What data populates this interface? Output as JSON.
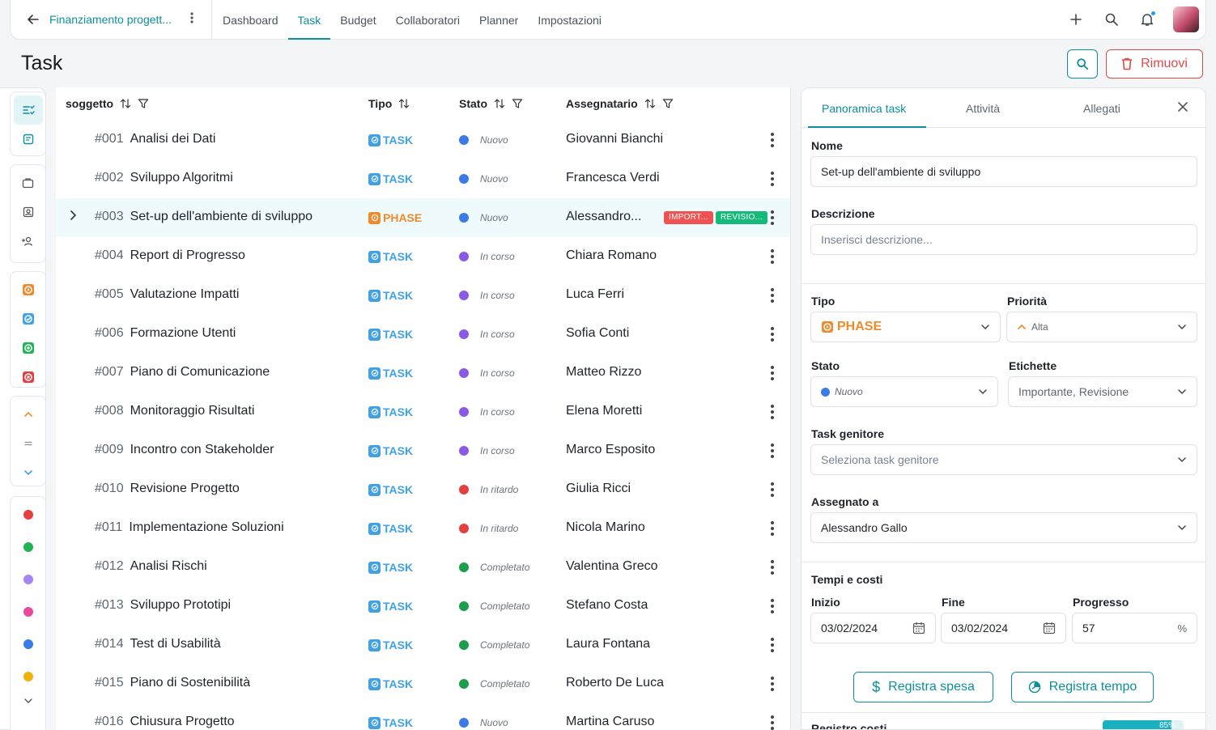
{
  "topbar": {
    "project_title": "Finanziamento progett...",
    "tabs": [
      "Dashboard",
      "Task",
      "Budget",
      "Collaboratori",
      "Planner",
      "Impostazioni"
    ],
    "active_tab": "Task"
  },
  "page": {
    "title": "Task",
    "remove_label": "Rimuovi"
  },
  "table": {
    "columns": [
      "soggetto",
      "Tipo",
      "Stato",
      "Assegnatario"
    ],
    "rows": [
      {
        "id": "#001",
        "subject": "Analisi dei Dati",
        "type": "TASK",
        "status": "Nuovo",
        "assignee": "Giovanni Bianchi"
      },
      {
        "id": "#002",
        "subject": "Sviluppo Algoritmi",
        "type": "TASK",
        "status": "Nuovo",
        "assignee": "Francesca Verdi"
      },
      {
        "id": "#003",
        "subject": "Set-up dell'ambiente di sviluppo",
        "type": "PHASE",
        "status": "Nuovo",
        "assignee": "Alessandro...",
        "tags": [
          "IMPORT...",
          "REVISIO..."
        ]
      },
      {
        "id": "#004",
        "subject": "Report di Progresso",
        "type": "TASK",
        "status": "In corso",
        "assignee": "Chiara Romano"
      },
      {
        "id": "#005",
        "subject": "Valutazione Impatti",
        "type": "TASK",
        "status": "In corso",
        "assignee": "Luca Ferri"
      },
      {
        "id": "#006",
        "subject": "Formazione Utenti",
        "type": "TASK",
        "status": "In corso",
        "assignee": "Sofia Conti"
      },
      {
        "id": "#007",
        "subject": "Piano di Comunicazione",
        "type": "TASK",
        "status": "In corso",
        "assignee": "Matteo Rizzo"
      },
      {
        "id": "#008",
        "subject": "Monitoraggio Risultati",
        "type": "TASK",
        "status": "In corso",
        "assignee": "Elena Moretti"
      },
      {
        "id": "#009",
        "subject": "Incontro con Stakeholder",
        "type": "TASK",
        "status": "In corso",
        "assignee": "Marco Esposito"
      },
      {
        "id": "#010",
        "subject": "Revisione Progetto",
        "type": "TASK",
        "status": "In ritardo",
        "assignee": "Giulia Ricci"
      },
      {
        "id": "#011",
        "subject": "Implementazione Soluzioni",
        "type": "TASK",
        "status": "In ritardo",
        "assignee": "Nicola Marino"
      },
      {
        "id": "#012",
        "subject": "Analisi Rischi",
        "type": "TASK",
        "status": "Completato",
        "assignee": "Valentina Greco"
      },
      {
        "id": "#013",
        "subject": "Sviluppo Prototipi",
        "type": "TASK",
        "status": "Completato",
        "assignee": "Stefano Costa"
      },
      {
        "id": "#014",
        "subject": "Test di Usabilità",
        "type": "TASK",
        "status": "Completato",
        "assignee": "Laura Fontana"
      },
      {
        "id": "#015",
        "subject": "Piano di Sostenibilità",
        "type": "TASK",
        "status": "Completato",
        "assignee": "Roberto De Luca"
      },
      {
        "id": "#016",
        "subject": "Chiusura Progetto",
        "type": "TASK",
        "status": "Nuovo",
        "assignee": "Martina Caruso"
      }
    ]
  },
  "status_colors": {
    "Nuovo": "#3b7be8",
    "In corso": "#8a5ae6",
    "In ritardo": "#e53f3f",
    "Completato": "#1e9e4a"
  },
  "type_colors": {
    "TASK": "#3fa2e6",
    "PHASE": "#f08a2a"
  },
  "tag_colors": [
    "#f05252",
    "#15b97a"
  ],
  "rail_dot_colors": [
    "#e53f3f",
    "#22b356",
    "#a685f0",
    "#e84a9b",
    "#3b7be8",
    "#f0b20a"
  ],
  "panel": {
    "tabs": [
      "Panoramica task",
      "Attività",
      "Allegati"
    ],
    "name_label": "Nome",
    "name_value": "Set-up dell'ambiente di sviluppo",
    "desc_label": "Descrizione",
    "desc_placeholder": "Inserisci descrizione...",
    "type_label": "Tipo",
    "type_value": "PHASE",
    "priority_label": "Priorità",
    "priority_value": "Alta",
    "state_label": "Stato",
    "state_value": "Nuovo",
    "tags_label": "Etichette",
    "tags_value": "Importante, Revisione",
    "parent_label": "Task genitore",
    "parent_placeholder": "Seleziona task genitore",
    "assigned_label": "Assegnato a",
    "assigned_value": "Alessandro Gallo",
    "time_cost_label": "Tempi e costi",
    "start_label": "Inizio",
    "start_value": "03/02/2024",
    "end_label": "Fine",
    "end_value": "03/02/2024",
    "progress_label": "Progresso",
    "progress_value": "57",
    "progress_unit": "%",
    "expense_btn": "Registra spesa",
    "time_btn": "Registra tempo",
    "cost_log_label": "Registro costi",
    "cost_progress": "85%"
  }
}
